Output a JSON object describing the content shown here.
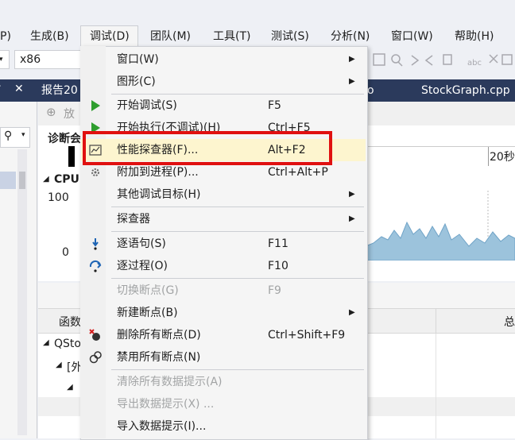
{
  "menubar": {
    "items": [
      "P)",
      "生成(B)",
      "调试(D)",
      "团队(M)",
      "工具(T)",
      "测试(S)",
      "分析(N)",
      "窗口(W)",
      "帮助(H)"
    ]
  },
  "toolbar": {
    "platform": "x86"
  },
  "tabs": {
    "left": "报告20",
    "mid": "o",
    "right": "StockGraph.cpp"
  },
  "diag": {
    "zoom_label": "放",
    "diag_label": "诊断会",
    "time_label": "20秒",
    "cpu_label": "CPU",
    "y_max": "100",
    "y_min": "0"
  },
  "lower": {
    "col_func": "函数",
    "col_total": "总",
    "tree1": "QSto",
    "tree2": "[外"
  },
  "menu": {
    "items": [
      {
        "label": "窗口(W)",
        "shortcut": "",
        "submenu": true,
        "disabled": false
      },
      {
        "label": "图形(C)",
        "shortcut": "",
        "submenu": true,
        "disabled": false
      },
      {
        "label": "开始调试(S)",
        "shortcut": "F5",
        "submenu": false,
        "disabled": false
      },
      {
        "label": "开始执行(不调试)(H)",
        "shortcut": "Ctrl+F5",
        "submenu": false,
        "disabled": false
      },
      {
        "label": "性能探查器(F)...",
        "shortcut": "Alt+F2",
        "submenu": false,
        "disabled": false
      },
      {
        "label": "附加到进程(P)...",
        "shortcut": "Ctrl+Alt+P",
        "submenu": false,
        "disabled": false
      },
      {
        "label": "其他调试目标(H)",
        "shortcut": "",
        "submenu": true,
        "disabled": false
      },
      {
        "label": "探查器",
        "shortcut": "",
        "submenu": true,
        "disabled": false
      },
      {
        "label": "逐语句(S)",
        "shortcut": "F11",
        "submenu": false,
        "disabled": false
      },
      {
        "label": "逐过程(O)",
        "shortcut": "F10",
        "submenu": false,
        "disabled": false
      },
      {
        "label": "切换断点(G)",
        "shortcut": "F9",
        "submenu": false,
        "disabled": true
      },
      {
        "label": "新建断点(B)",
        "shortcut": "",
        "submenu": true,
        "disabled": false
      },
      {
        "label": "删除所有断点(D)",
        "shortcut": "Ctrl+Shift+F9",
        "submenu": false,
        "disabled": false
      },
      {
        "label": "禁用所有断点(N)",
        "shortcut": "",
        "submenu": false,
        "disabled": false
      },
      {
        "label": "清除所有数据提示(A)",
        "shortcut": "",
        "submenu": false,
        "disabled": true
      },
      {
        "label": "导出数据提示(X) ...",
        "shortcut": "",
        "submenu": false,
        "disabled": true
      },
      {
        "label": "导入数据提示(I)...",
        "shortcut": "",
        "submenu": false,
        "disabled": false
      }
    ],
    "highlighted": "性能探查器(F)..."
  },
  "colors": {
    "highlight": "#fdf5cf",
    "red_box": "#e01010",
    "run_green": "#2e9e2e",
    "step_blue": "#1e64b4",
    "chart_fill": "#9cc3dc"
  }
}
